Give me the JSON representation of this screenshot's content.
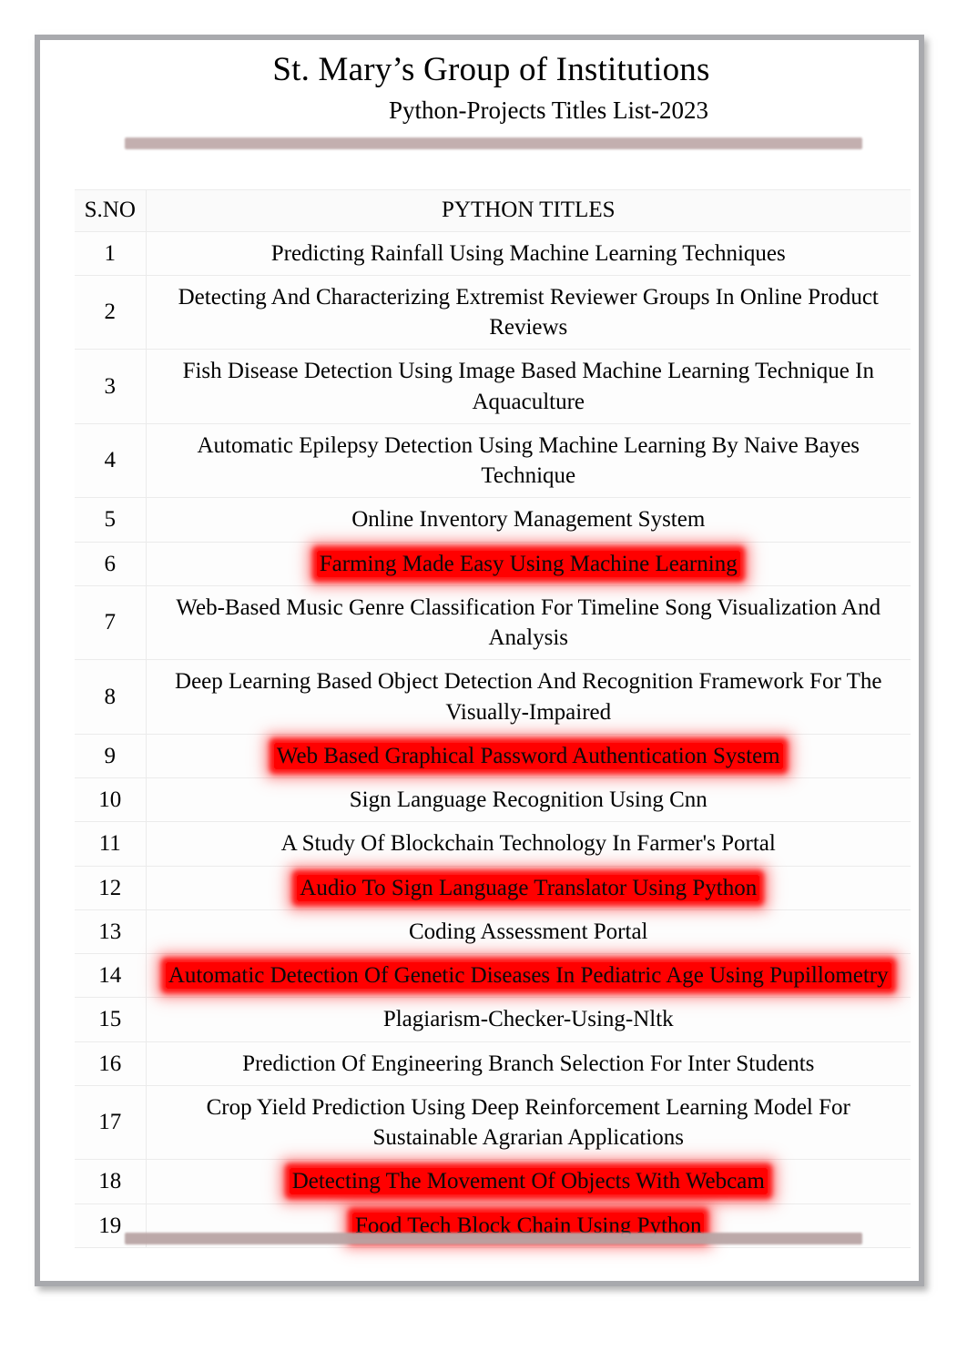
{
  "document": {
    "main_title": "St. Mary’s Group of Institutions",
    "sub_title": "Python-Projects Titles List-2023"
  },
  "table": {
    "headers": {
      "sno": "S.NO",
      "title": "PYTHON TITLES"
    },
    "rows": [
      {
        "sno": "1",
        "title": "Predicting Rainfall Using Machine Learning Techniques",
        "highlight": false
      },
      {
        "sno": "2",
        "title": "Detecting And Characterizing Extremist Reviewer Groups In Online Product Reviews",
        "highlight": false
      },
      {
        "sno": "3",
        "title": "Fish Disease Detection Using Image Based Machine Learning Technique In Aquaculture",
        "highlight": false
      },
      {
        "sno": "4",
        "title": "Automatic Epilepsy Detection Using Machine Learning By Naive Bayes Technique",
        "highlight": false
      },
      {
        "sno": "5",
        "title": "Online Inventory Management System",
        "highlight": false
      },
      {
        "sno": "6",
        "title": "Farming Made Easy Using Machine Learning",
        "highlight": true
      },
      {
        "sno": "7",
        "title": "Web-Based Music Genre Classification For Timeline Song Visualization And Analysis",
        "highlight": false
      },
      {
        "sno": "8",
        "title": "Deep Learning Based Object Detection And Recognition Framework For The Visually-Impaired",
        "highlight": false
      },
      {
        "sno": "9",
        "title": "Web Based Graphical Password Authentication System",
        "highlight": true
      },
      {
        "sno": "10",
        "title": "Sign Language Recognition Using Cnn",
        "highlight": false
      },
      {
        "sno": "11",
        "title": "A Study Of Blockchain Technology In Farmer's Portal",
        "highlight": false
      },
      {
        "sno": "12",
        "title": "Audio To Sign Language Translator Using Python",
        "highlight": true
      },
      {
        "sno": "13",
        "title": "Coding Assessment Portal",
        "highlight": false
      },
      {
        "sno": "14",
        "title": "Automatic Detection Of Genetic Diseases In Pediatric Age Using Pupillometry",
        "highlight": true
      },
      {
        "sno": "15",
        "title": "Plagiarism-Checker-Using-Nltk",
        "highlight": false
      },
      {
        "sno": "16",
        "title": "Prediction Of Engineering Branch Selection For Inter Students",
        "highlight": false
      },
      {
        "sno": "17",
        "title": "Crop Yield Prediction Using Deep Reinforcement Learning Model For Sustainable Agrarian Applications",
        "highlight": false
      },
      {
        "sno": "18",
        "title": "Detecting The Movement Of Objects With Webcam",
        "highlight": true
      },
      {
        "sno": "19",
        "title": "Food Tech Block Chain Using Python",
        "highlight": true
      }
    ]
  },
  "decoration": {
    "top_bar_color": "#c0abab",
    "bottom_bar_color": "#b9a5a5",
    "highlight_color": "#ff0000",
    "frame_color": "#a8a9ad"
  }
}
